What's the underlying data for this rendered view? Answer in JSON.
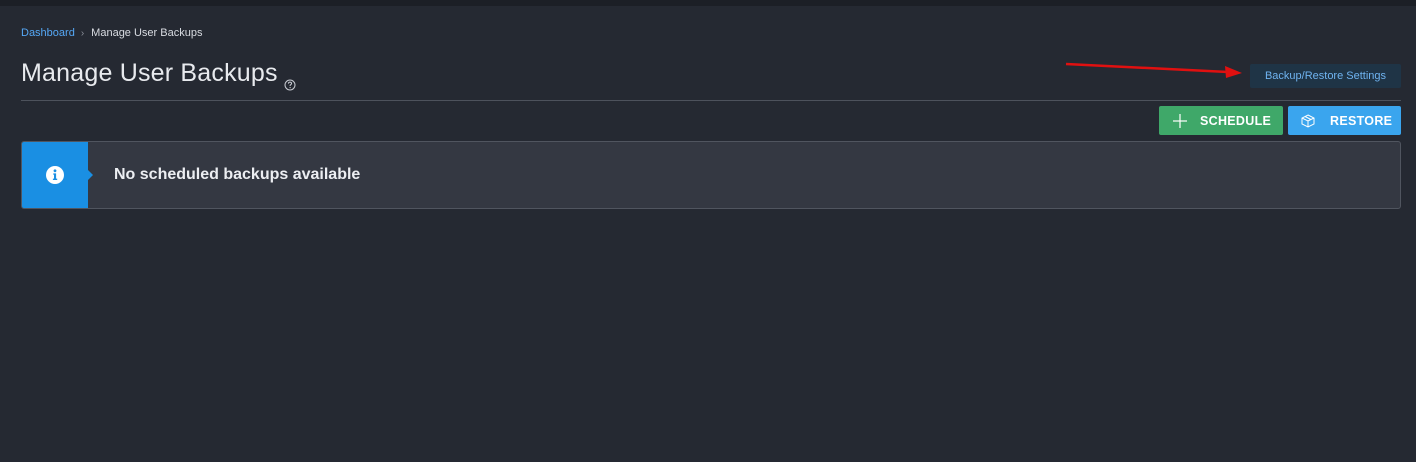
{
  "breadcrumb": {
    "parent": "Dashboard",
    "current": "Manage User Backups"
  },
  "page": {
    "title": "Manage User Backups"
  },
  "toolbar": {
    "settings_label": "Backup/Restore Settings",
    "schedule_label": "SCHEDULE",
    "restore_label": "RESTORE"
  },
  "alert": {
    "message": "No scheduled backups available"
  },
  "icons": {
    "help": "help-circle-icon",
    "schedule": "plus-icon",
    "restore": "box-icon",
    "info": "info-icon",
    "annotation": "red-arrow"
  },
  "colors": {
    "background": "#252932",
    "accent_blue": "#1a8fe3",
    "schedule_green": "#3fa869",
    "restore_blue": "#3aa5ee",
    "link": "#55a7f5",
    "annotation_red": "#e01010"
  }
}
